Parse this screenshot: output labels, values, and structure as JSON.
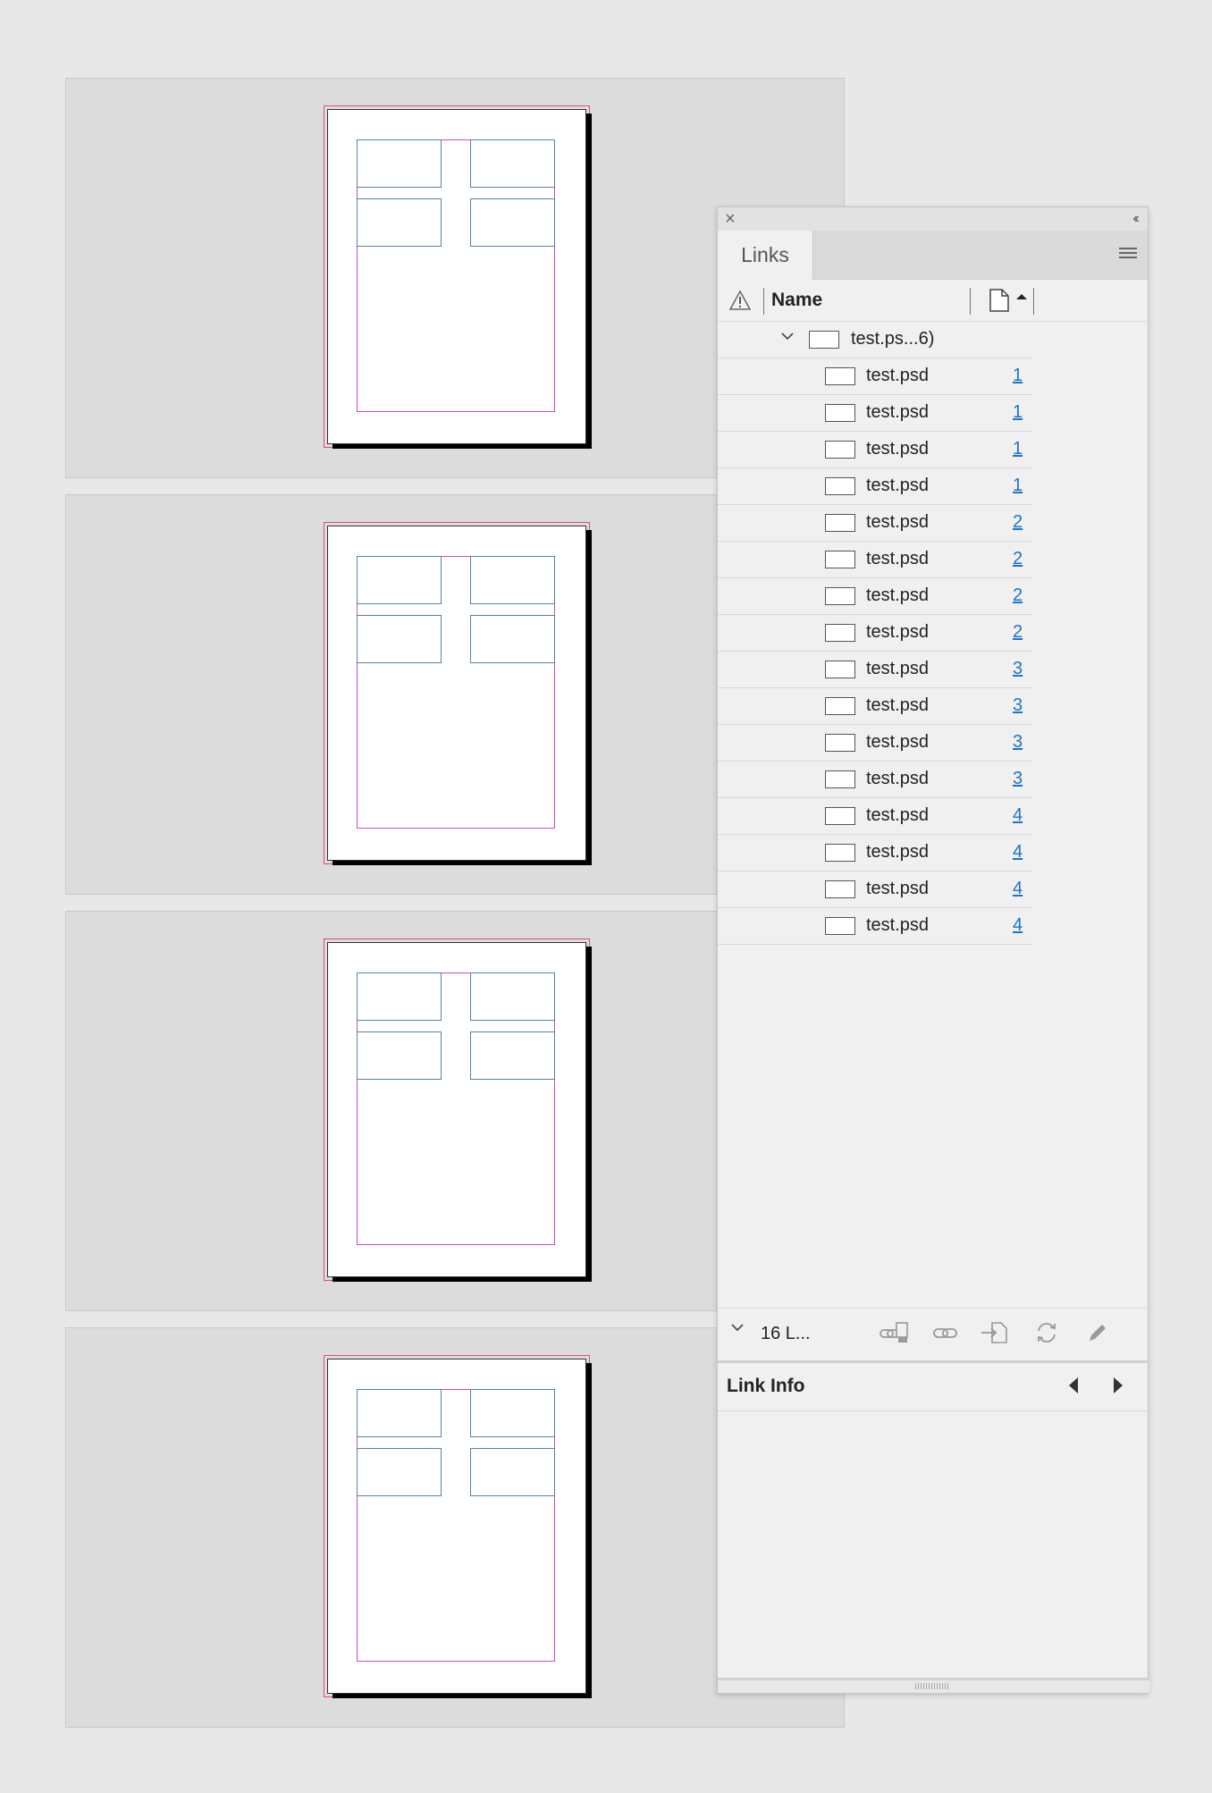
{
  "canvas": {
    "spread_count": 4
  },
  "panel": {
    "close_label": "×",
    "collapse_label": "‹‹",
    "tab_label": "Links",
    "column_name_label": "Name",
    "parent_row": {
      "name": "test.ps...6)"
    },
    "rows": [
      {
        "name": "test.psd",
        "page": "1"
      },
      {
        "name": "test.psd",
        "page": "1"
      },
      {
        "name": "test.psd",
        "page": "1"
      },
      {
        "name": "test.psd",
        "page": "1"
      },
      {
        "name": "test.psd",
        "page": "2"
      },
      {
        "name": "test.psd",
        "page": "2"
      },
      {
        "name": "test.psd",
        "page": "2"
      },
      {
        "name": "test.psd",
        "page": "2"
      },
      {
        "name": "test.psd",
        "page": "3"
      },
      {
        "name": "test.psd",
        "page": "3"
      },
      {
        "name": "test.psd",
        "page": "3"
      },
      {
        "name": "test.psd",
        "page": "3"
      },
      {
        "name": "test.psd",
        "page": "4"
      },
      {
        "name": "test.psd",
        "page": "4"
      },
      {
        "name": "test.psd",
        "page": "4"
      },
      {
        "name": "test.psd",
        "page": "4"
      }
    ],
    "status_label": "16 L...",
    "link_info_label": "Link Info",
    "icons": {
      "warning": "warning-icon",
      "page": "page-icon",
      "relink_cc": "relink-from-cc-libraries-icon",
      "relink": "relink-icon",
      "goto": "go-to-link-icon",
      "update": "update-link-icon",
      "edit": "edit-original-icon"
    }
  },
  "colors": {
    "bleed_guide": "#e14f6e",
    "margin_guide": "#c94bd0",
    "frame_outline": "#5a7fa8",
    "link_text": "#1c74c4"
  }
}
